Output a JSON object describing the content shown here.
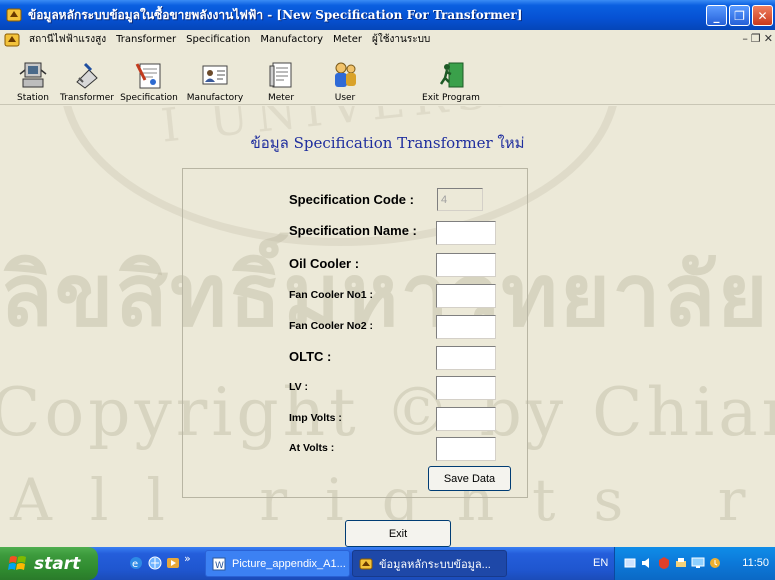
{
  "window": {
    "title": "ข้อมูลหลักระบบข้อมูลในซื้อขายพลังงานไฟฟ้า - [New Specification For Transformer]",
    "controls": [
      "minimize",
      "maximize",
      "close"
    ]
  },
  "menu": {
    "items": [
      "สถานีไฟฟ้าแรงสูง",
      "Transformer",
      "Specification",
      "Manufactory",
      "Meter",
      "ผู้ใช้งานระบบ"
    ]
  },
  "toolbar": {
    "buttons": [
      {
        "label": "Station",
        "icon": "station-icon"
      },
      {
        "label": "Transformer",
        "icon": "transformer-icon"
      },
      {
        "label": "Specification",
        "icon": "specification-icon"
      },
      {
        "label": "Manufactory",
        "icon": "manufactory-icon"
      },
      {
        "label": "Meter",
        "icon": "meter-icon"
      },
      {
        "label": "User",
        "icon": "user-icon"
      },
      {
        "label": "Exit Program",
        "icon": "exit-program-icon"
      }
    ]
  },
  "form": {
    "title": "ข้อมูล Specification Transformer ใหม่",
    "fields": [
      {
        "label": "Specification Code :",
        "value": "4"
      },
      {
        "label": "Specification Name :",
        "value": ""
      },
      {
        "label": "Oil Cooler :",
        "value": ""
      },
      {
        "label": "Fan Cooler No1 :",
        "value": ""
      },
      {
        "label": "Fan Cooler No2 :",
        "value": ""
      },
      {
        "label": "OLTC :",
        "value": ""
      },
      {
        "label": "LV :",
        "value": ""
      },
      {
        "label": "Imp Volts :",
        "value": ""
      },
      {
        "label": "At Volts :",
        "value": ""
      }
    ],
    "save_label": "Save Data",
    "exit_label": "Exit"
  },
  "watermark": {
    "arc_text": "I UNIVERSITY",
    "line1": "ลิขสิทธิ์มหาวิทยาลัยเชียงใหม่",
    "line2": "Copyright © by Chiang Mai University",
    "line3": "All rights reserved"
  },
  "taskbar": {
    "start_label": "start",
    "tasks": [
      {
        "label": "Picture_appendix_A1...",
        "active": false
      },
      {
        "label": "ข้อมูลหลักระบบข้อมูล...",
        "active": true
      }
    ],
    "language": "EN",
    "clock": "11:50"
  }
}
